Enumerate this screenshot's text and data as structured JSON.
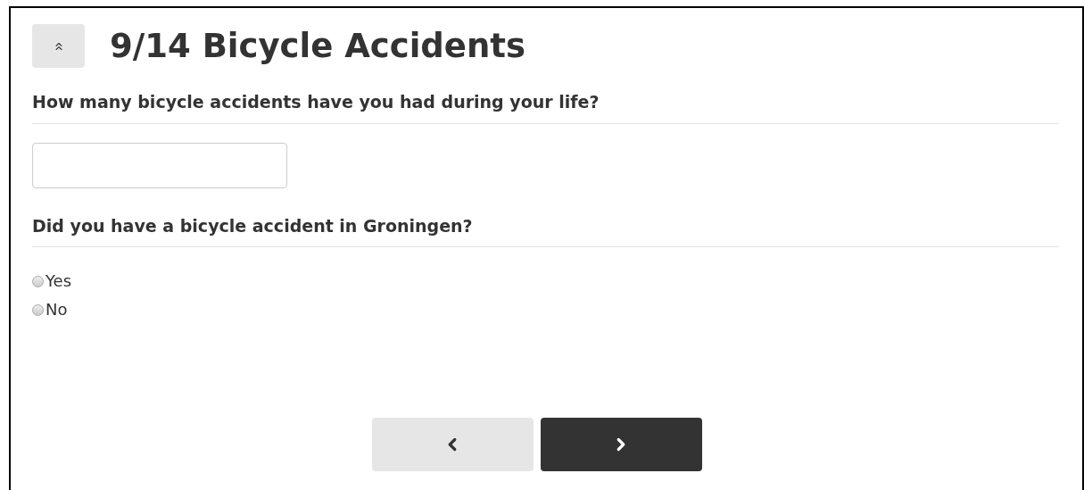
{
  "header": {
    "title": "9/14 Bicycle Accidents"
  },
  "questions": [
    {
      "kind": "number",
      "label": "How many bicycle accidents have you had during your life?"
    },
    {
      "kind": "radio",
      "label": "Did you have a bicycle accident in Groningen?",
      "options": [
        {
          "label": "Yes",
          "selected": false
        },
        {
          "label": "No",
          "selected": false
        }
      ]
    }
  ]
}
